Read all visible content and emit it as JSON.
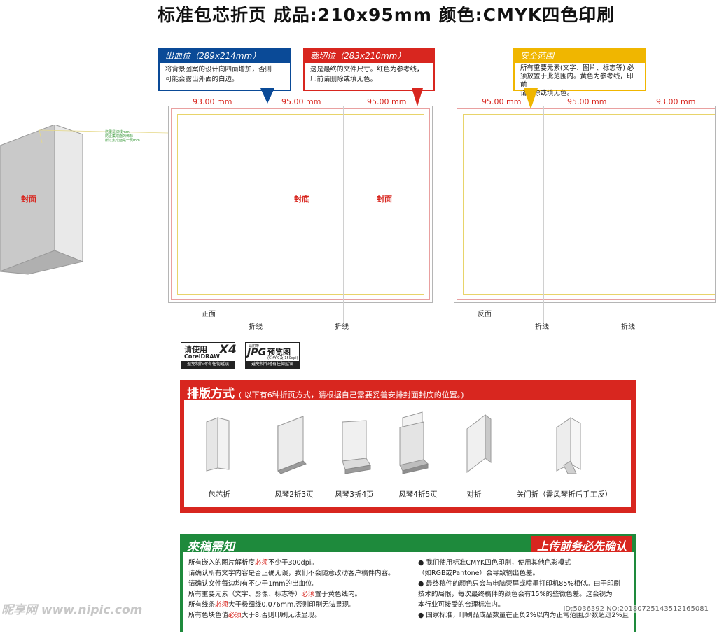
{
  "title": "标准包芯折页  成品:210x95mm  颜色:CMYK四色印刷",
  "callouts": {
    "bleed": {
      "title": "出血位（289x214mm）",
      "text": [
        "将背景图案的设计向四面增加，否则",
        "可能会露出外面的白边。"
      ]
    },
    "trim": {
      "title": "裁切位（283x210mm）",
      "text": [
        "这是最终的文件尺寸。红色为参考线，",
        "印前请删除或填无色。"
      ]
    },
    "safe": {
      "title": "安全范围",
      "text": [
        "所有重要元素(文字、图片、标志等) 必",
        "须放置于此范围内。黄色为参考线，印前",
        "请删除或填无色。"
      ]
    }
  },
  "front": {
    "dims": [
      "93.00 mm",
      "95.00 mm",
      "95.00 mm"
    ],
    "labels": [
      "封底",
      "封面"
    ],
    "side_label": "正面",
    "fold_labels": [
      "折线",
      "折线"
    ]
  },
  "back": {
    "dims": [
      "95.00 mm",
      "95.00 mm",
      "93.00 mm"
    ],
    "side_label": "反面",
    "fold_labels": [
      "折线",
      "折线"
    ]
  },
  "mockup": {
    "cover_label": "封面",
    "notes": [
      "这里是切线mm",
      "防止集成面的稀标",
      "所以集成面是一页mm"
    ]
  },
  "badges": {
    "corel": {
      "line1": "请使用",
      "version": "X4",
      "line2": "CorelDRAW",
      "strip": "避免制作时有任何延误"
    },
    "jpg": {
      "pre": "请附带",
      "big": "JPG",
      "cn": "预览图",
      "sub": "(CMYK 及 150dpi)",
      "strip": "避免制作时有任何延误"
    }
  },
  "layout_section": {
    "title": "排版方式",
    "subtitle": "( 以下有6种折页方式，请根据自己需要妥善安排封面封底的位置。)",
    "items": [
      "包芯折",
      "风琴2折3页",
      "风琴3折4页",
      "风琴4折5页",
      "对折",
      "关门折（需风琴折后手工反）"
    ]
  },
  "notes_section": {
    "title": "來稿需知",
    "tag": "上传前务必先确认",
    "left": [
      [
        "所有嵌入的图片解析度",
        "必须",
        "不少于300dpi。"
      ],
      [
        "请确认所有文字内容是否正确无误，我们不会随意改动客户稿件内容。",
        "",
        ""
      ],
      [
        "请确认文件每边均有不少于1mm的出血位。",
        "",
        ""
      ],
      [
        "所有重要元素（文字、影像、标志等）",
        "必须",
        "置于黄色线内。"
      ],
      [
        "所有线条",
        "必须",
        "大于极细线0.076mm,否则印刷无法显现。"
      ],
      [
        "所有色块色值",
        "必须",
        "大于8,否则印刷无法显现。"
      ]
    ],
    "right": [
      "● 我们使用标准CMYK四色印刷，使用其他色彩模式",
      "   （如RGB或Pantone）会导致输出色差。",
      "● 最终稿件的颜色只会与电脑荧屏或喷墨打印机85%相似。由于印刷",
      "   技术的局限，每次最终稿件的颜色会有15%的些微色差。这会视为",
      "   本行业可接受的合理标准内。",
      "● 国家标准，印刷品成品数量在正负2%以内为正常范围,少数超过2%且"
    ]
  },
  "watermark_left": "昵享网 www.nipic.com",
  "watermark_right": "ID:5036392 NO:20180725143512165081",
  "colors": {
    "blue": "#0a4a97",
    "red": "#d8261f",
    "yellow": "#f0b600",
    "green": "#1e8a3c"
  }
}
